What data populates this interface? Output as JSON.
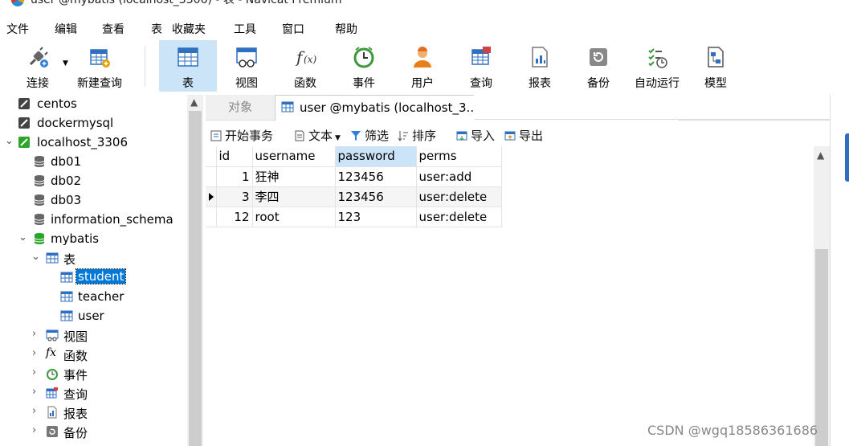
{
  "window": {
    "title": "user @mybatis (localhost_3306) - 表 - Navicat Premium"
  },
  "menu": [
    "文件",
    "编辑",
    "查看",
    "表",
    "收藏夹",
    "工具",
    "窗口",
    "帮助"
  ],
  "toolbar": [
    {
      "label": "连接",
      "icon": "plug-icon"
    },
    {
      "label": "新建查询",
      "icon": "new-query-icon"
    },
    {
      "label": "表",
      "icon": "table-icon",
      "active": true
    },
    {
      "label": "视图",
      "icon": "view-icon"
    },
    {
      "label": "函数",
      "icon": "function-icon"
    },
    {
      "label": "事件",
      "icon": "clock-icon"
    },
    {
      "label": "用户",
      "icon": "user-icon"
    },
    {
      "label": "查询",
      "icon": "query-icon"
    },
    {
      "label": "报表",
      "icon": "report-icon"
    },
    {
      "label": "备份",
      "icon": "backup-icon"
    },
    {
      "label": "自动运行",
      "icon": "schedule-icon"
    },
    {
      "label": "模型",
      "icon": "model-icon"
    }
  ],
  "sidebar": {
    "connections": [
      "centos",
      "dockermysql",
      "localhost_3306"
    ],
    "databases": [
      "db01",
      "db02",
      "db03",
      "information_schema",
      "mybatis"
    ],
    "tables_group": "表",
    "tables": [
      "student",
      "teacher",
      "user"
    ],
    "selected_table": "student",
    "groups": [
      "视图",
      "函数",
      "事件",
      "查询",
      "报表",
      "备份"
    ]
  },
  "tabs": {
    "objects": "对象",
    "active": "user @mybatis (localhost_3..."
  },
  "subtoolbar": {
    "begin": "开始事务",
    "text": "文本",
    "filter": "筛选",
    "sort": "排序",
    "import": "导入",
    "export": "导出"
  },
  "grid": {
    "columns": [
      "id",
      "username",
      "password",
      "perms"
    ],
    "rows": [
      [
        "1",
        "狂神",
        "123456",
        "user:add"
      ],
      [
        "3",
        "李四",
        "123456",
        "user:delete"
      ],
      [
        "12",
        "root",
        "123",
        "user:delete"
      ]
    ],
    "current_row": 1
  },
  "watermark": "CSDN @wgq18586361686",
  "colors": {
    "accent": "#cce4f7",
    "selection": "#0078d7",
    "db_green": "#2aa52a"
  }
}
